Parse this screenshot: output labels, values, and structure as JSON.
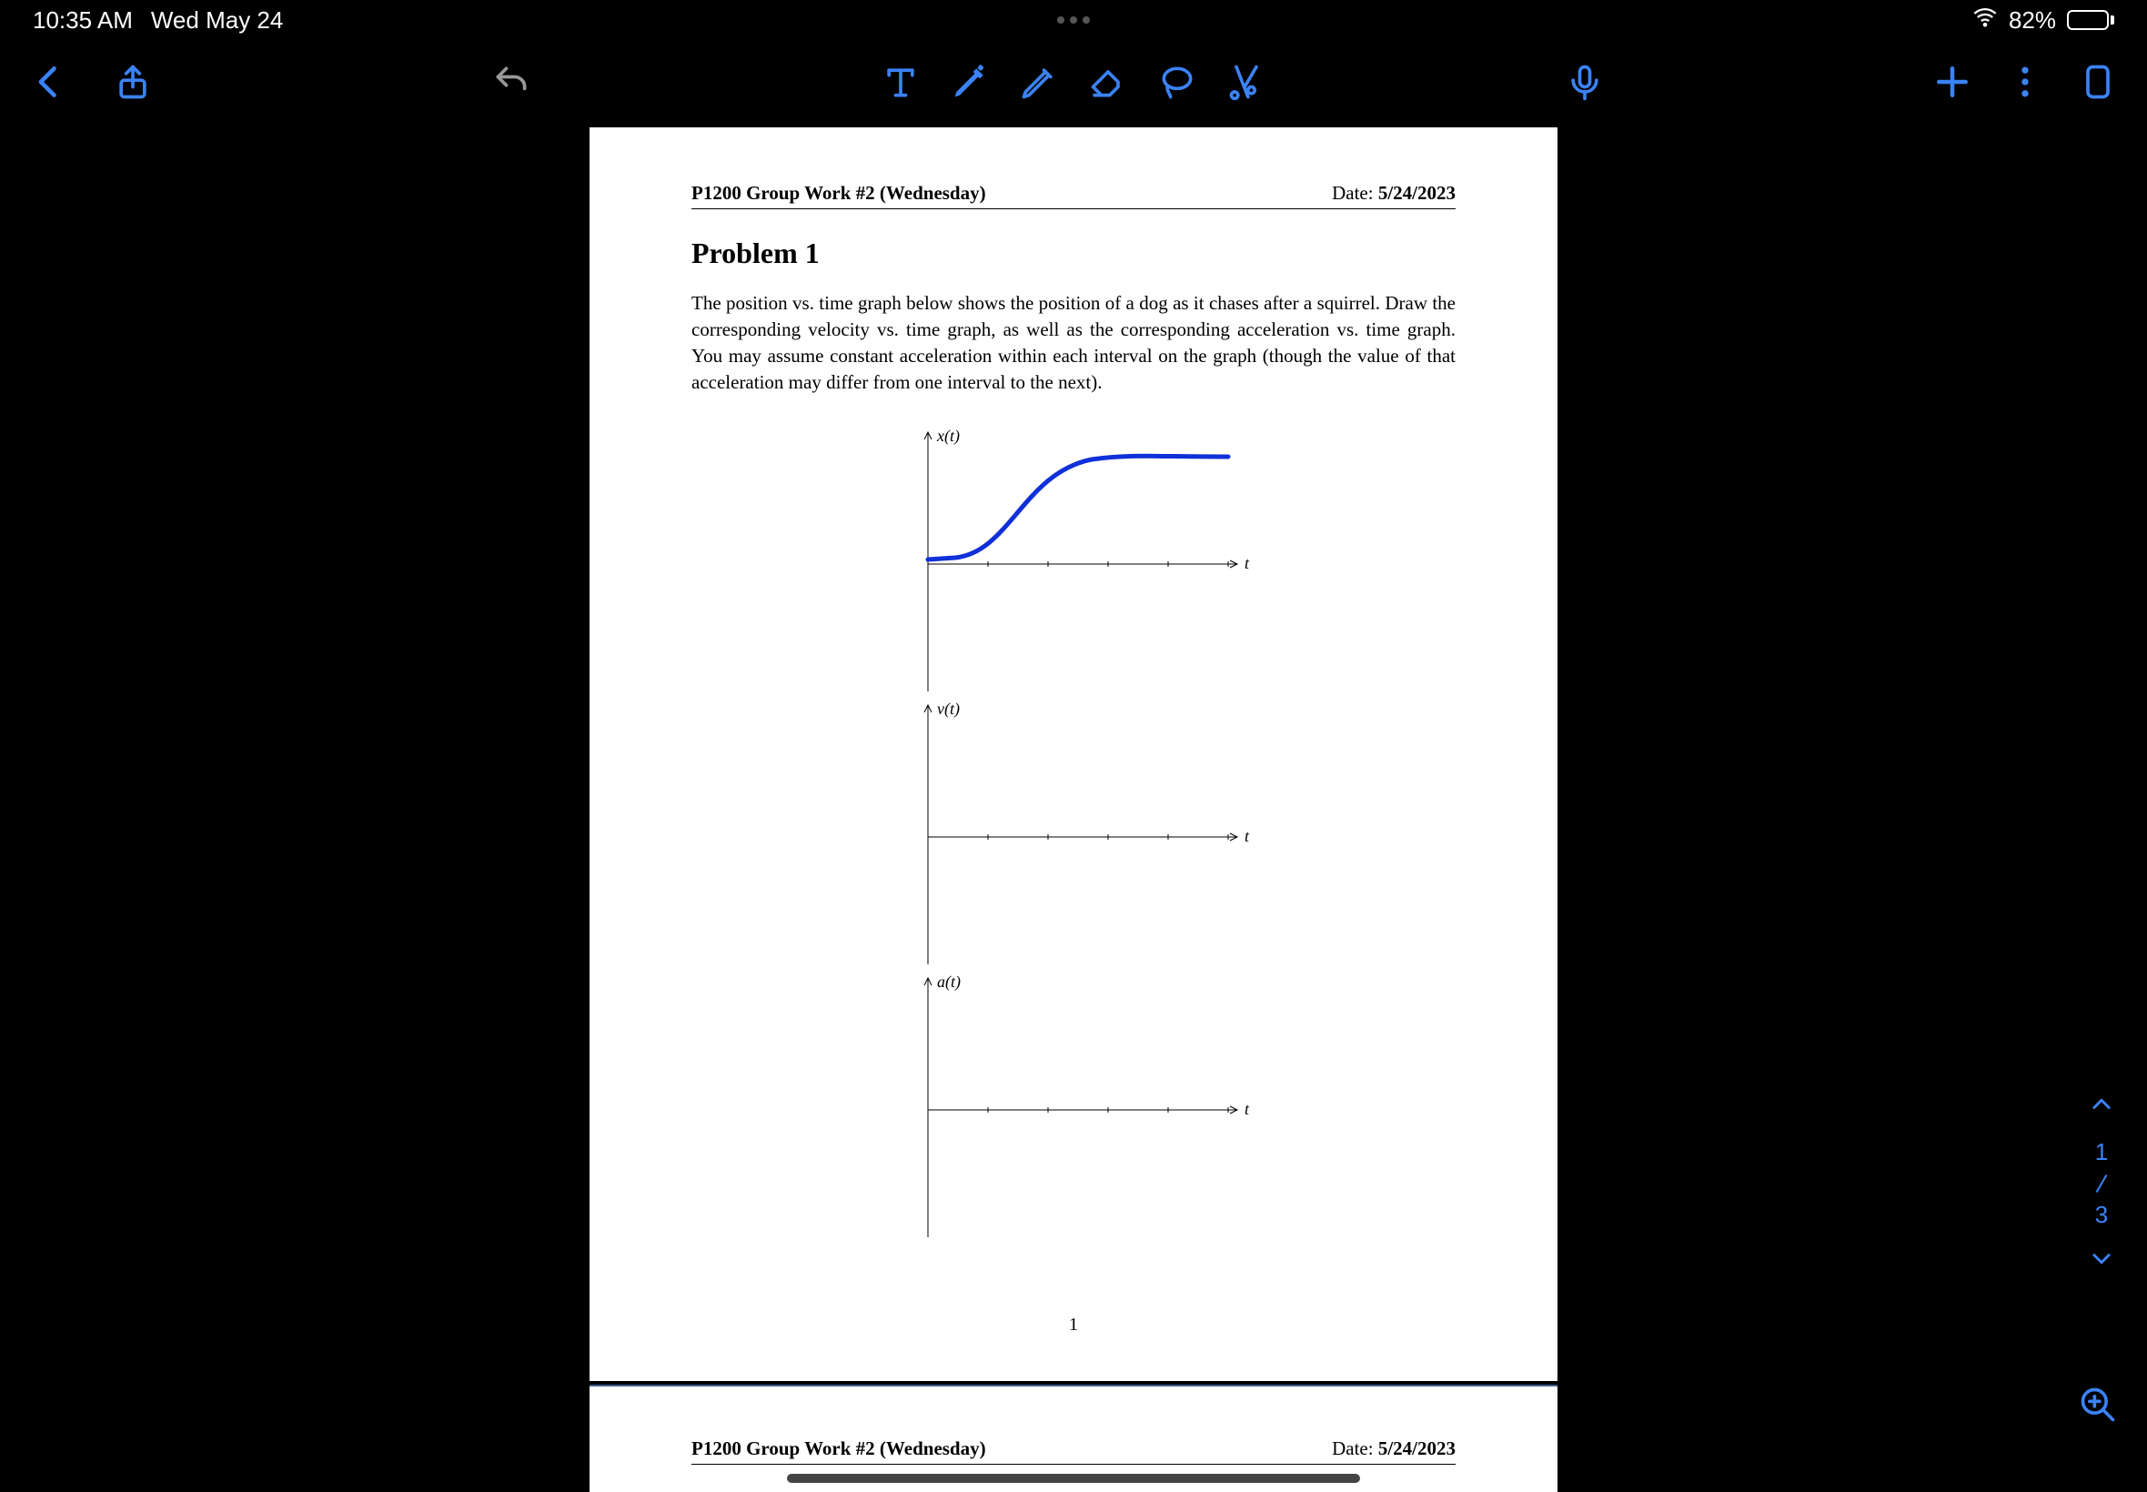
{
  "status": {
    "time": "10:35 AM",
    "date": "Wed May 24",
    "battery_pct": "82%",
    "battery_fill": 82
  },
  "toolbar": {
    "icons": [
      "back",
      "share",
      "undo",
      "text",
      "pencil",
      "highlighter",
      "eraser",
      "lasso",
      "cut",
      "mic",
      "add",
      "more",
      "page-mode"
    ]
  },
  "pagenav": {
    "current": "1",
    "total": "3"
  },
  "document": {
    "header_title": "P1200 Group Work #2 (Wednesday)",
    "date_label": "Date: ",
    "date_value": "5/24/2023",
    "problem_title": "Problem 1",
    "body_text": "The position vs. time graph below shows the position of a dog as it chases after a squirrel. Draw the corresponding velocity vs. time graph, as well as the corresponding acceleration vs. time graph. You may assume constant acceleration within each interval on the graph (though the value of that acceleration may differ from one interval to the next).",
    "graph_labels": {
      "g1_y": "x(t)",
      "g2_y": "v(t)",
      "g3_y": "a(t)",
      "x": "t"
    },
    "page_number": "1"
  },
  "chart_data": [
    {
      "type": "line",
      "title": "x(t)",
      "xlabel": "t",
      "ylabel": "x(t)",
      "x": [
        0,
        1,
        2,
        3,
        4,
        5
      ],
      "values": [
        0,
        0.2,
        1.5,
        3.0,
        3.2,
        3.2
      ],
      "note": "S-curve: flat near 0, rises steeply between t~1 and t~3, plateaus after t~3.5. Units on axes not given. Ticks at t=1..5."
    },
    {
      "type": "line",
      "title": "v(t)",
      "xlabel": "t",
      "ylabel": "v(t)",
      "x": [
        0,
        1,
        2,
        3,
        4,
        5
      ],
      "values": null,
      "note": "Blank axes for student to fill in"
    },
    {
      "type": "line",
      "title": "a(t)",
      "xlabel": "t",
      "ylabel": "a(t)",
      "x": [
        0,
        1,
        2,
        3,
        4,
        5
      ],
      "values": null,
      "note": "Blank axes for student to fill in"
    }
  ]
}
